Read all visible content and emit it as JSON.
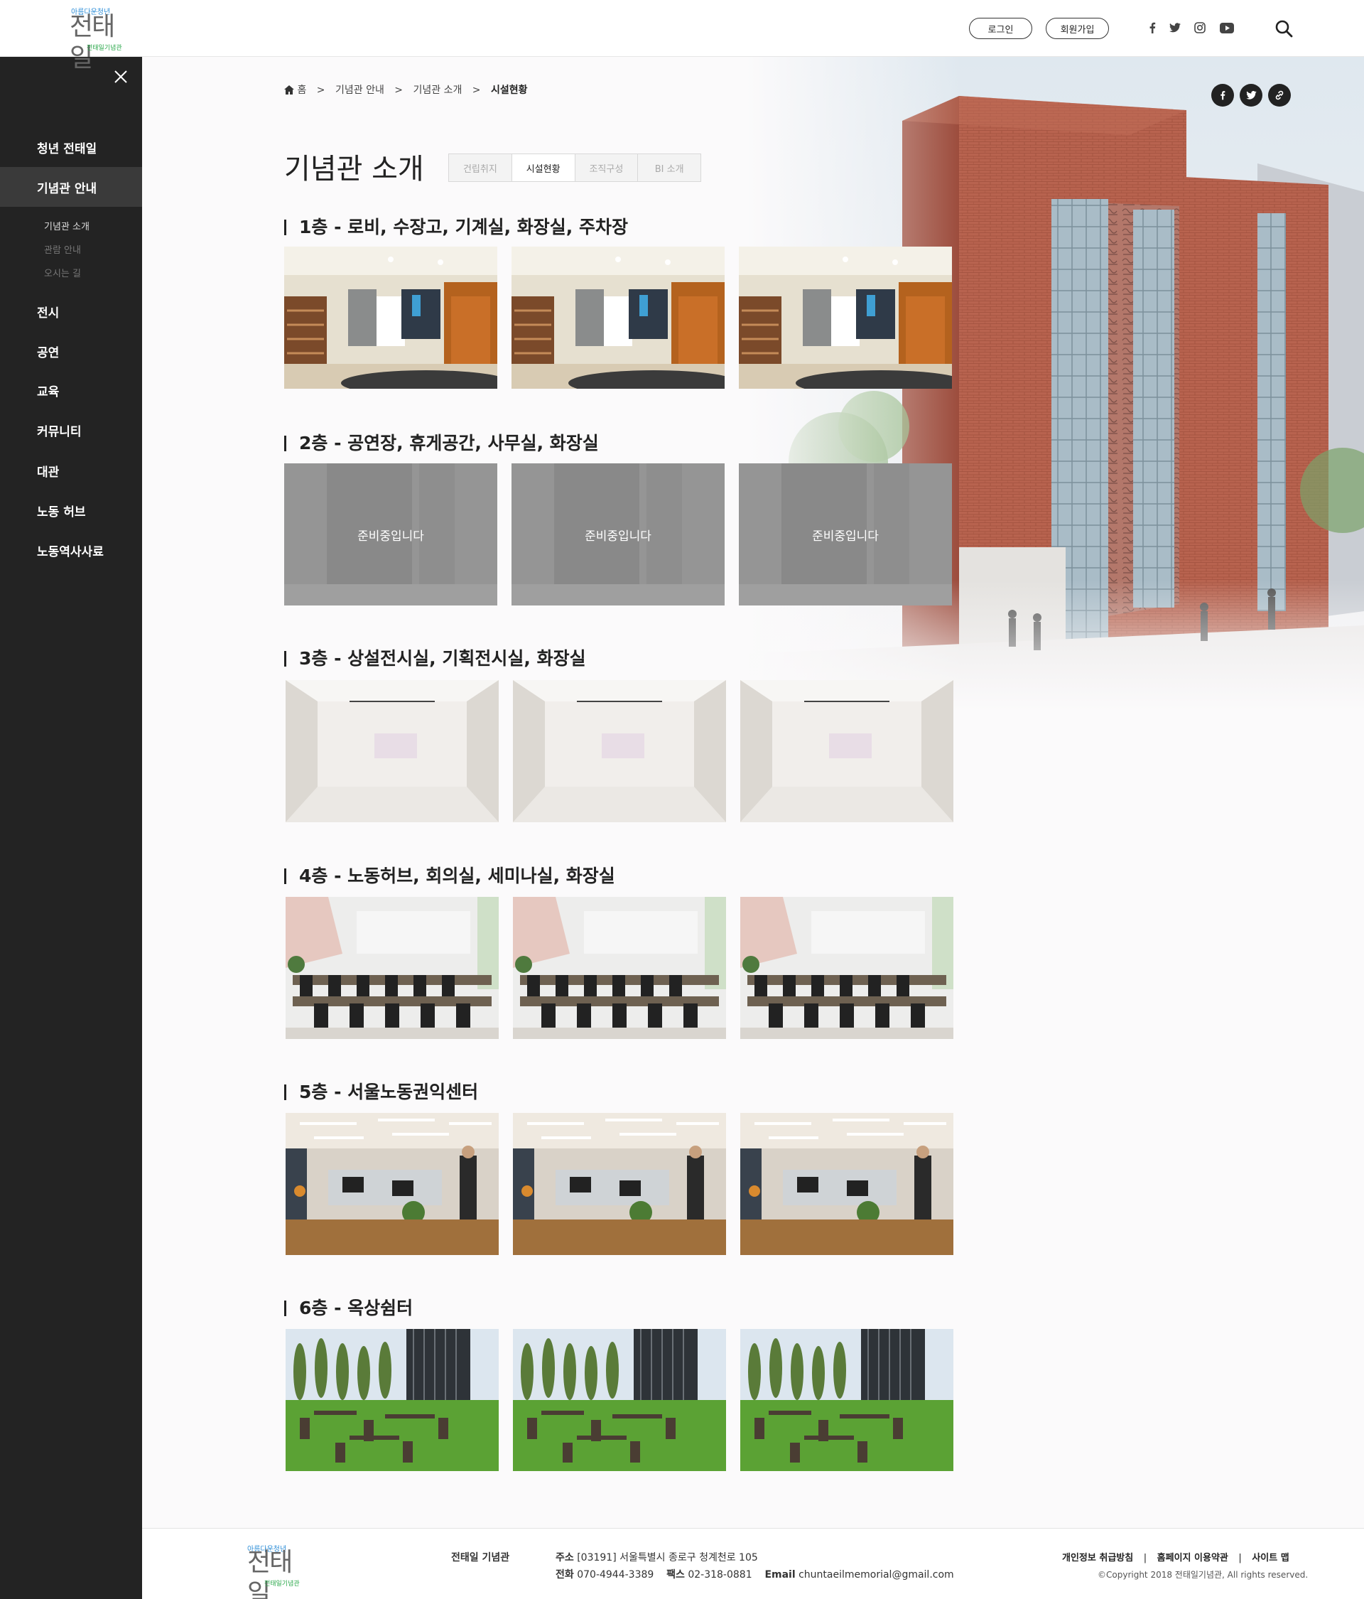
{
  "header": {
    "logo_top": "아름다운청년",
    "logo_main": "전태일",
    "logo_bottom": "전태일기념관",
    "login_label": "로그인",
    "signup_label": "회원가입",
    "social_icons": [
      "facebook-icon",
      "twitter-icon",
      "instagram-icon",
      "youtube-icon"
    ]
  },
  "sidebar": {
    "items": [
      {
        "label": "청년 전태일"
      },
      {
        "label": "기념관 안내"
      },
      {
        "label": "전시"
      },
      {
        "label": "공연"
      },
      {
        "label": "교육"
      },
      {
        "label": "커뮤니티"
      },
      {
        "label": "대관"
      },
      {
        "label": "노동 허브"
      },
      {
        "label": "노동역사사료"
      }
    ],
    "sub_items": [
      {
        "label": "기념관 소개"
      },
      {
        "label": "관람 안내"
      },
      {
        "label": "오시는 길"
      }
    ]
  },
  "breadcrumb": {
    "home": "홈",
    "sep": ">",
    "level1": "기념관 안내",
    "level2": "기념관 소개",
    "current": "시설현황"
  },
  "page": {
    "title": "기념관 소개",
    "tabs": [
      {
        "label": "건립취지"
      },
      {
        "label": "시설현황"
      },
      {
        "label": "조직구성"
      },
      {
        "label": "BI 소개"
      }
    ]
  },
  "sections": [
    {
      "title": "1층 - 로비, 수장고, 기계실, 화장실, 주차장"
    },
    {
      "title": "2층 - 공연장, 휴게공간, 사무실, 화장실",
      "placeholder": "준비중입니다"
    },
    {
      "title": "3층 - 상설전시실, 기획전시실, 화장실"
    },
    {
      "title": "4층 - 노동허브, 회의실, 세미나실, 화장실"
    },
    {
      "title": "5층 - 서울노동권익센터"
    },
    {
      "title": "6층 - 옥상쉼터"
    }
  ],
  "footer": {
    "org_name": "전태일 기념관",
    "addr_label": "주소",
    "addr_value": "[03191] 서울특별시 종로구 청계천로 105",
    "tel_label": "전화",
    "tel_value": "070-4944-3389",
    "fax_label": "팩스",
    "fax_value": "02-318-0881",
    "email_label": "Email",
    "email_value": "chuntaeilmemorial@gmail.com",
    "links": [
      "개인정보 취급방침",
      "홈페이지 이용약관",
      "사이트 맵"
    ],
    "link_sep": "|",
    "copyright": "©Copyright 2018 전태일기념관, All rights reserved."
  }
}
